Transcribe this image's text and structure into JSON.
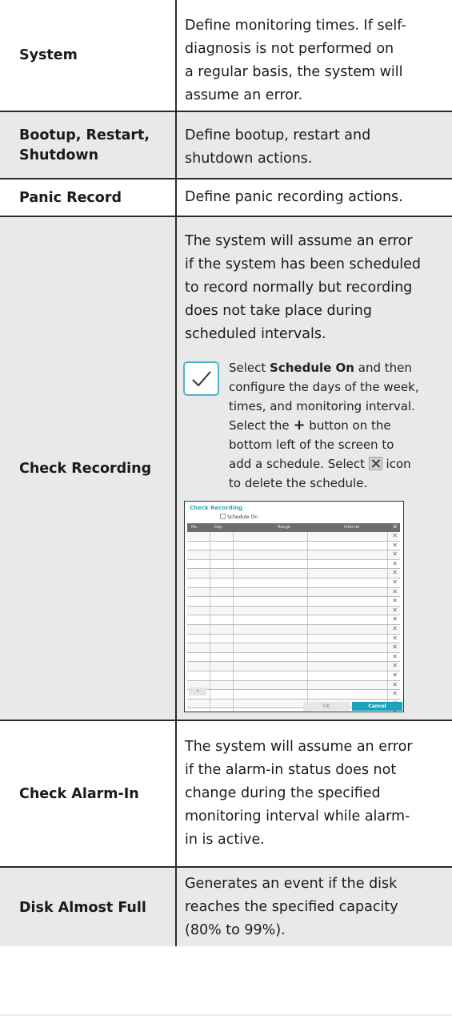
{
  "rows": [
    {
      "name": "System",
      "description": [
        "Define monitoring times. If self-",
        "diagnosis is not performed on",
        "a regular basis, the system will",
        "assume an error."
      ]
    },
    {
      "name_lines": [
        "Bootup, Restart,",
        "Shutdown"
      ],
      "description": [
        "Define bootup, restart and",
        "shutdown actions."
      ]
    },
    {
      "name": "Panic Record",
      "description": [
        "Define panic recording actions."
      ]
    },
    {
      "name": "Check Recording",
      "description": [
        "The system will assume an error",
        "if the system has been scheduled",
        "to record normally but recording",
        "does not take place during",
        "scheduled intervals."
      ]
    },
    {
      "name": "Check Alarm-In",
      "description": [
        "The system will assume an error",
        "if the alarm-in status does not",
        "change during the specified",
        "monitoring interval while alarm-",
        "in is active."
      ]
    },
    {
      "name": "Disk Almost Full",
      "description": [
        "Generates an event if the disk",
        "reaches the specified capacity",
        "(80% to 99%)."
      ]
    }
  ],
  "note": {
    "icon": "checkmark-icon",
    "line1_pre": "Select ",
    "line1_bold": "Schedule On",
    "line1_post": " and then",
    "line2": "configure the days of the week,",
    "line3": "times, and monitoring interval.",
    "line4_pre": "Select the ",
    "plus": "+",
    "line4_post": " button on the",
    "line5": "bottom left of the screen to",
    "line6_pre": "add a schedule. Select ",
    "delete_icon": "delete-x-icon",
    "line6_post": " icon",
    "line7": "to delete the schedule."
  },
  "dialog": {
    "title": "Check Recording",
    "schedule_label": "Schedule On",
    "headers": [
      "No.",
      "Day",
      "Range",
      "Interval"
    ],
    "row_count": 20,
    "add_label": "+",
    "ok_label": "OK",
    "cancel_label": "Cancel",
    "accent_color": "#1aa3bd"
  }
}
